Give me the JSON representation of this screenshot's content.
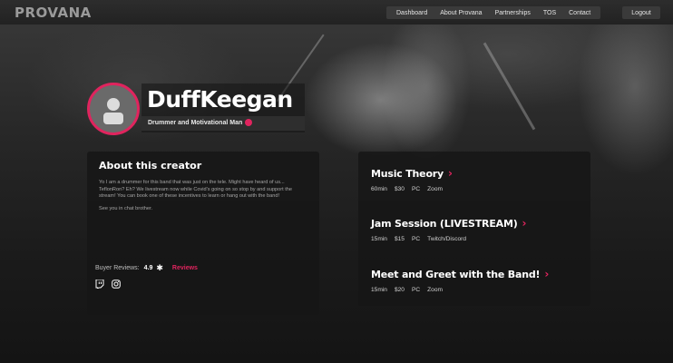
{
  "brand": {
    "logo_text": "PROVANA",
    "accent": "#e0245e"
  },
  "nav": {
    "items": [
      "Dashboard",
      "About Provana",
      "Partnerships",
      "TOS",
      "Contact"
    ],
    "logout_label": "Logout"
  },
  "profile": {
    "name": "DuffKeegan",
    "tagline": "Drummer and Motivational Man",
    "avatar_icon": "user-placeholder-icon"
  },
  "about": {
    "title": "About this creator",
    "paragraph1": "Yo I am a drummer for this band that was just on the tele. Might have heard of us... TeflonRon? Eh? We livestream now while Covid's going on so stop by and support the stream! You can book one of these incentives to learn or hang out with the band!",
    "paragraph2": "See you in chat brother.",
    "reviews_label": "Buyer Reviews:",
    "rating": "4.9",
    "reviews_link": "Reviews",
    "social_icons": [
      "twitch-icon",
      "instagram-icon"
    ]
  },
  "incentives": [
    {
      "title": "Music Theory",
      "duration": "60min",
      "price": "$30",
      "platform": "PC",
      "location": "Zoom"
    },
    {
      "title": "Jam Session (LIVESTREAM)",
      "duration": "15min",
      "price": "$15",
      "platform": "PC",
      "location": "Twitch/Discord"
    },
    {
      "title": "Meet and Greet with the Band!",
      "duration": "15min",
      "price": "$20",
      "platform": "PC",
      "location": "Zoom"
    }
  ]
}
